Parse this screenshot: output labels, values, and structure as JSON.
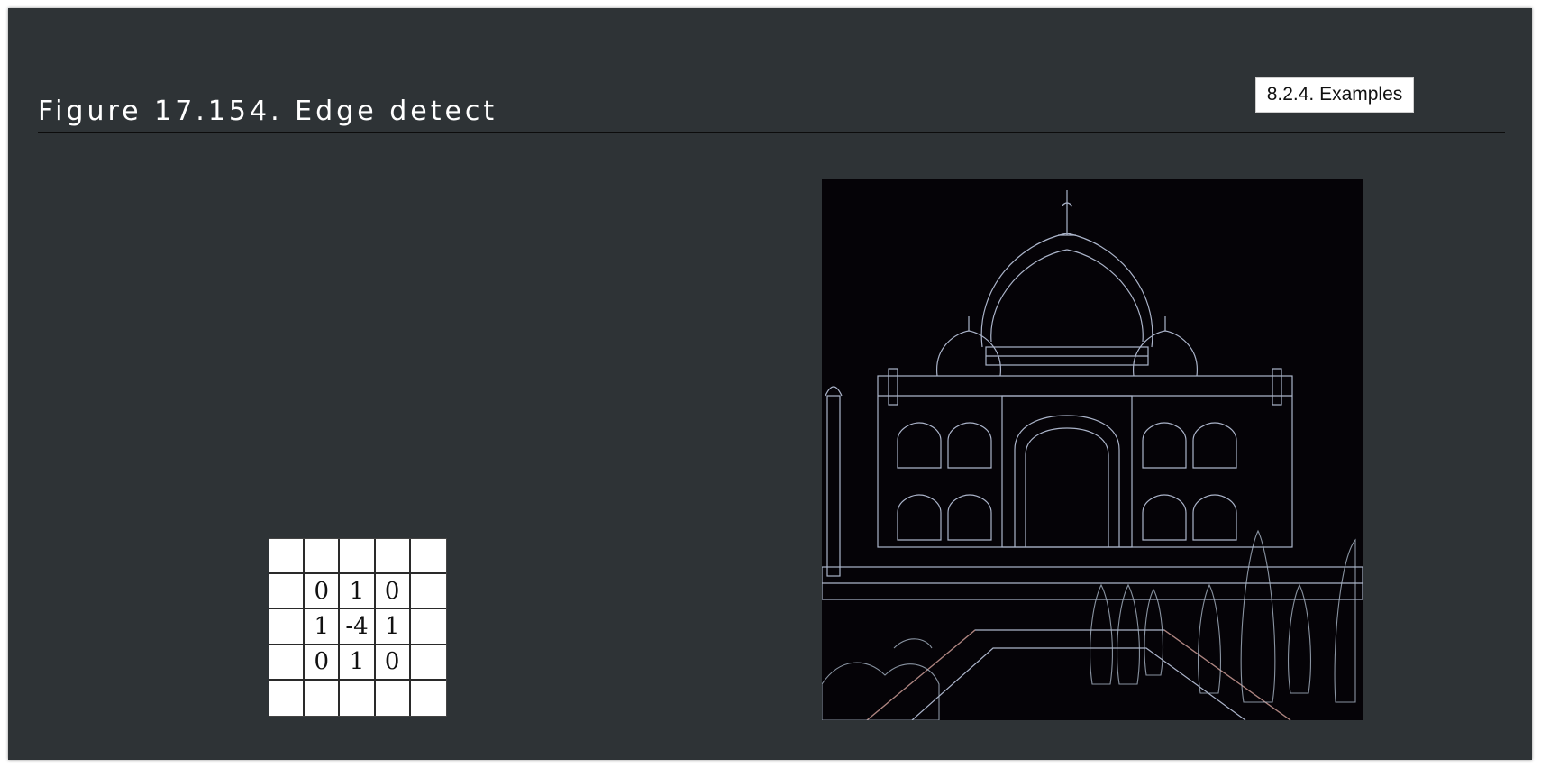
{
  "figure": {
    "title": "Figure 17.154. Edge detect"
  },
  "nav": {
    "breadcrumb_label": "8.2.4. Examples"
  },
  "kernel": {
    "cells": [
      [
        "",
        "",
        "",
        "",
        ""
      ],
      [
        "",
        "0",
        "1",
        "0",
        ""
      ],
      [
        "",
        "1",
        "-4",
        "1",
        ""
      ],
      [
        "",
        "0",
        "1",
        "0",
        ""
      ],
      [
        "",
        "",
        "",
        "",
        ""
      ]
    ]
  },
  "result_image": {
    "icon": "edge-detected-taj-mahal-image",
    "colors": {
      "background": "#050307",
      "edges": "#c9d4ec",
      "warm_edges": "#b07060"
    }
  }
}
